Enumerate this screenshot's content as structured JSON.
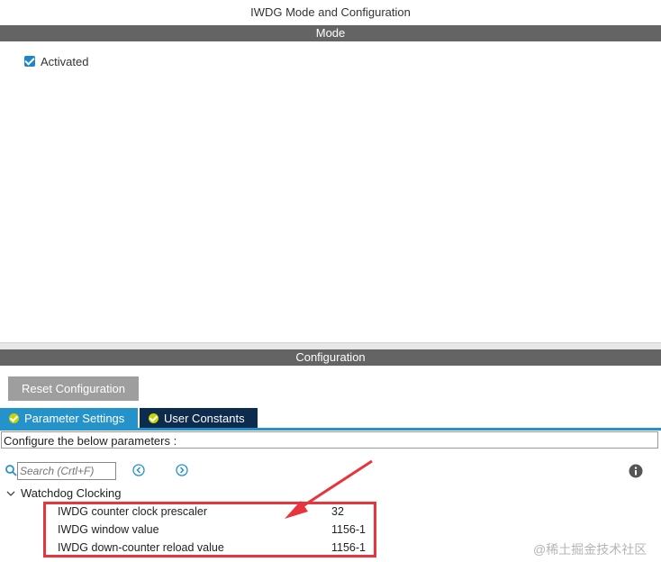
{
  "window": {
    "title": "IWDG Mode and Configuration"
  },
  "mode": {
    "header": "Mode",
    "activated": {
      "label": "Activated",
      "checked": true
    }
  },
  "configuration": {
    "header": "Configuration",
    "reset_label": "Reset Configuration",
    "tabs": [
      {
        "label": "Parameter Settings",
        "active": true
      },
      {
        "label": "User Constants",
        "active": false
      }
    ],
    "configure_text": "Configure the below parameters :",
    "search_placeholder": "Search (Crtl+F)",
    "group": {
      "label": "Watchdog Clocking",
      "params": [
        {
          "name": "IWDG counter clock prescaler",
          "value": "32"
        },
        {
          "name": "IWDG window value",
          "value": "1156-1"
        },
        {
          "name": "IWDG down-counter reload value",
          "value": "1156-1"
        }
      ]
    }
  },
  "watermark": "@稀土掘金技术社区",
  "colors": {
    "accent_blue": "#2592c9",
    "dark_tab": "#0d2b4d",
    "highlight_red": "#e8343c",
    "header_gray": "#646464"
  },
  "icons": [
    "search-icon",
    "prev-arrow-icon",
    "next-arrow-icon",
    "info-icon",
    "chevron-down-icon",
    "check-circle-icon",
    "checkbox-icon"
  ]
}
